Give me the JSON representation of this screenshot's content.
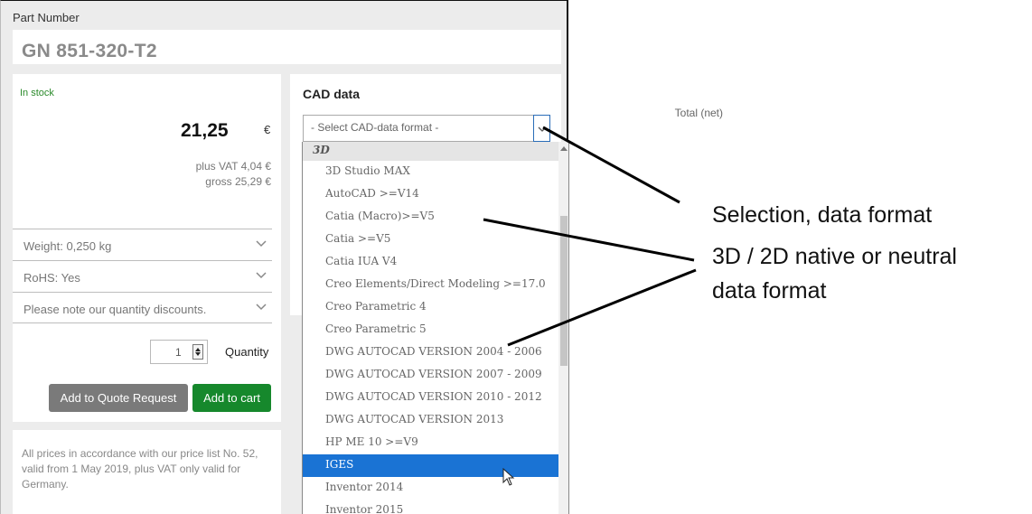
{
  "header": {
    "part_number_label": "Part Number",
    "part_number_value": "GN 851-320-T2"
  },
  "pricing": {
    "stock_status": "In stock",
    "total_label": "Total (net)",
    "price": "21,25",
    "currency": "€",
    "vat_line": "plus VAT 4,04 €",
    "gross_line": "gross 25,29 €"
  },
  "details": [
    {
      "label": "Weight: 0,250 kg"
    },
    {
      "label": "RoHS: Yes"
    },
    {
      "label": "Please note our quantity discounts."
    }
  ],
  "quantity": {
    "value": "1",
    "label": "Quantity"
  },
  "buttons": {
    "quote": "Add to Quote Request",
    "cart": "Add to cart"
  },
  "footnote": "All prices in accordance with our price list No. 52, valid from 1 May 2019, plus VAT only valid for Germany.",
  "cad": {
    "title": "CAD data",
    "select_placeholder": "- Select CAD-data format -",
    "group": "3D",
    "options": [
      "3D Studio MAX",
      "AutoCAD >=V14",
      "Catia (Macro)>=V5",
      "Catia >=V5",
      "Catia IUA V4",
      "Creo Elements/Direct Modeling >=17.0",
      "Creo Parametric 4",
      "Creo Parametric 5",
      "DWG AUTOCAD VERSION 2004 - 2006",
      "DWG AUTOCAD VERSION 2007 - 2009",
      "DWG AUTOCAD VERSION 2010 - 2012",
      "DWG AUTOCAD VERSION 2013",
      "HP ME 10 >=V9",
      "IGES",
      "Inventor 2014",
      "Inventor 2015"
    ],
    "selected_option": "IGES"
  },
  "annotations": {
    "selection": "Selection, data format",
    "format_line1": "3D / 2D native or neutral",
    "format_line2": "data format"
  },
  "colors": {
    "accent_green": "#16882c",
    "highlight_blue": "#1a73d4",
    "stock_green": "#2a8a2a"
  },
  "icons": {
    "chevron": "chevron-down-icon",
    "cursor": "mouse-pointer-icon"
  }
}
